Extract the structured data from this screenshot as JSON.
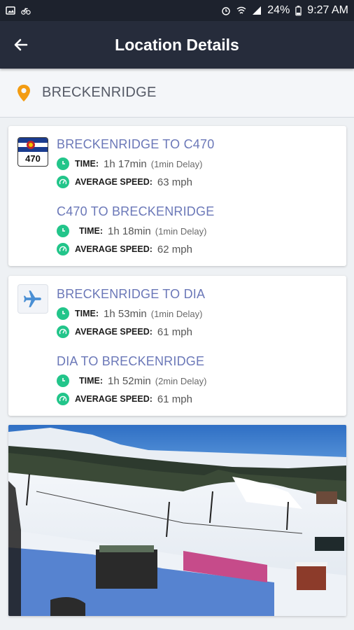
{
  "status_bar": {
    "battery": "24%",
    "time": "9:27 AM"
  },
  "app_bar": {
    "title": "Location Details"
  },
  "location": {
    "name": "BRECKENRIDGE"
  },
  "cards": [
    {
      "badge_icon": "colorado-470-shield-icon",
      "badge_text": "470",
      "routes": [
        {
          "title": "BRECKENRIDGE TO C470",
          "time_label": "TIME:",
          "time": "1h 17min",
          "delay": "(1min Delay)",
          "speed_label": "AVERAGE SPEED:",
          "speed": "63 mph"
        },
        {
          "title": "C470 TO BRECKENRIDGE",
          "time_label": "TIME:",
          "time": "1h 18min",
          "delay": "(1min Delay)",
          "speed_label": "AVERAGE SPEED:",
          "speed": "62 mph"
        }
      ]
    },
    {
      "badge_icon": "airplane-icon",
      "routes": [
        {
          "title": "BRECKENRIDGE TO DIA",
          "time_label": "TIME:",
          "time": "1h 53min",
          "delay": "(1min Delay)",
          "speed_label": "AVERAGE SPEED:",
          "speed": "61 mph"
        },
        {
          "title": "DIA TO BRECKENRIDGE",
          "time_label": "TIME:",
          "time": "1h 52min",
          "delay": "(2min Delay)",
          "speed_label": "AVERAGE SPEED:",
          "speed": "61 mph"
        }
      ]
    }
  ],
  "colors": {
    "accent_route": "#6b78b8",
    "icon_green": "#22c58a",
    "appbar": "#262c3b",
    "location_pin": "#f39c12"
  }
}
